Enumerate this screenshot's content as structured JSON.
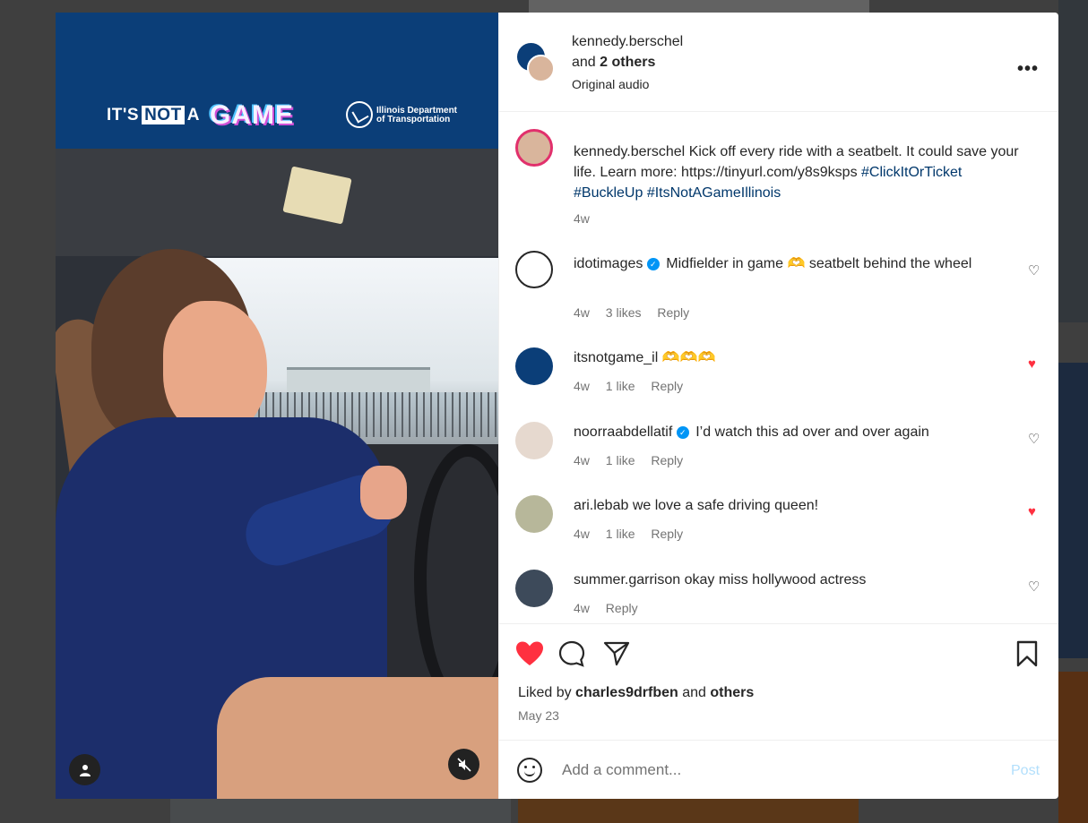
{
  "header": {
    "username": "kennedy.berschel",
    "and_label": "and",
    "others_label": "2 others",
    "audio": "Original audio",
    "more_icon": "more-icon"
  },
  "media": {
    "brand_its": "IT'S",
    "brand_not": "NOT",
    "brand_a": "A",
    "brand_game": "GAME",
    "brand_org": "Illinois Department of Transportation"
  },
  "caption": {
    "username": "kennedy.berschel",
    "text": "Kick off every ride with a seatbelt. It could save your life. Learn more: https://tinyurl.com/y8s9ksps",
    "tags": "#ClickItOrTicket #BuckleUp #ItsNotAGameIllinois",
    "time": "4w"
  },
  "comments": [
    {
      "username": "idotimages",
      "verified": true,
      "text": "Midfielder in game 🫶 seatbelt behind the wheel",
      "time": "4w",
      "likes": "3 likes",
      "reply": "Reply",
      "liked": false
    },
    {
      "username": "itsnotgame_il",
      "verified": false,
      "text": "🫶🫶🫶",
      "time": "4w",
      "likes": "1 like",
      "reply": "Reply",
      "liked": true
    },
    {
      "username": "noorraabdellatif",
      "verified": true,
      "text": "I’d watch this ad over and over again",
      "time": "4w",
      "likes": "1 like",
      "reply": "Reply",
      "liked": false
    },
    {
      "username": "ari.lebab",
      "verified": false,
      "text": "we love a safe driving queen!",
      "time": "4w",
      "likes": "1 like",
      "reply": "Reply",
      "liked": true
    },
    {
      "username": "summer.garrison",
      "verified": false,
      "text": "okay miss hollywood actress",
      "time": "4w",
      "likes": "",
      "reply": "Reply",
      "liked": false
    }
  ],
  "actions": {
    "liked_prefix": "Liked by",
    "liked_user": "charles9drfben",
    "liked_and": "and",
    "liked_others": "others",
    "date": "May 23"
  },
  "add_comment": {
    "placeholder": "Add a comment...",
    "post_label": "Post"
  },
  "colors": {
    "like_red": "#ff3040",
    "link_blue": "#00376b",
    "verified_blue": "#0095f6",
    "post_disabled": "#b2dffc"
  }
}
